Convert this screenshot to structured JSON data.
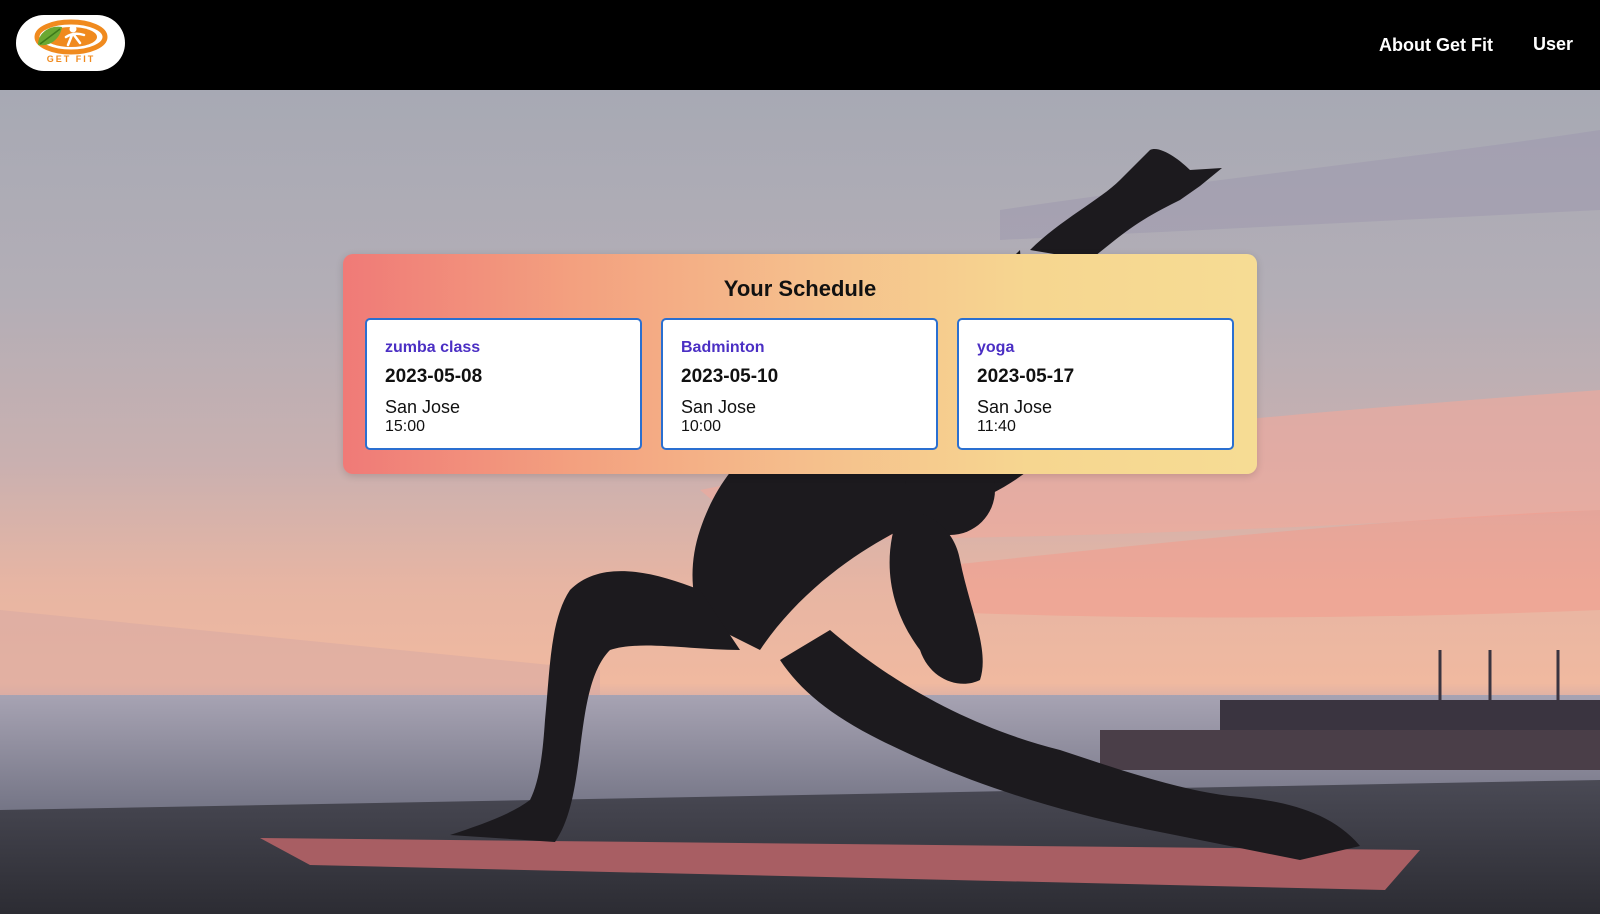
{
  "nav": {
    "about_label": "About Get Fit",
    "user_label": "User"
  },
  "logo": {
    "text": "GET FIT",
    "icon": "leaf-figure-logo"
  },
  "schedule": {
    "title": "Your Schedule",
    "events": [
      {
        "name": "zumba class",
        "date": "2023-05-08",
        "location": "San Jose",
        "time": "15:00"
      },
      {
        "name": "Badminton",
        "date": "2023-05-10",
        "location": "San Jose",
        "time": "10:00"
      },
      {
        "name": "yoga",
        "date": "2023-05-17",
        "location": "San Jose",
        "time": "11:40"
      }
    ]
  },
  "colors": {
    "navbar": "#000000",
    "card_border": "#2a6fd0",
    "event_name": "#4b2fc4",
    "panel_gradient_start": "#f07a77",
    "panel_gradient_end": "#f6dc94"
  }
}
